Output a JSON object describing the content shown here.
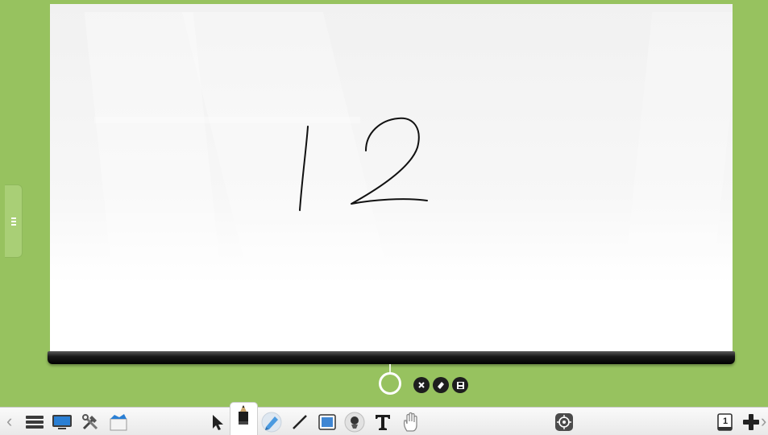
{
  "board": {
    "handwriting": "12",
    "background": "#ffffff"
  },
  "colors": {
    "frame": "#97c25f",
    "roller": "#000000",
    "toolbar": "#f2f2f2",
    "accent_blue": "#2a7fd4"
  },
  "page_controls": {
    "icons": [
      "pull-ring-icon",
      "close-icon",
      "eraser-icon",
      "save-icon"
    ]
  },
  "toolbar": {
    "left_icons": [
      "menu-icon",
      "display-icon",
      "tools-icon",
      "resources-icon"
    ],
    "tools": [
      "select-arrow-icon",
      "pen-icon",
      "highlighter-icon",
      "line-icon",
      "rectangle-icon",
      "spotlight-icon",
      "text-icon",
      "hand-icon"
    ],
    "active_tool": "pen-icon",
    "center_icon": "target-icon",
    "page_number": "1",
    "right_icons": [
      "page-icon",
      "add-page-icon"
    ]
  }
}
